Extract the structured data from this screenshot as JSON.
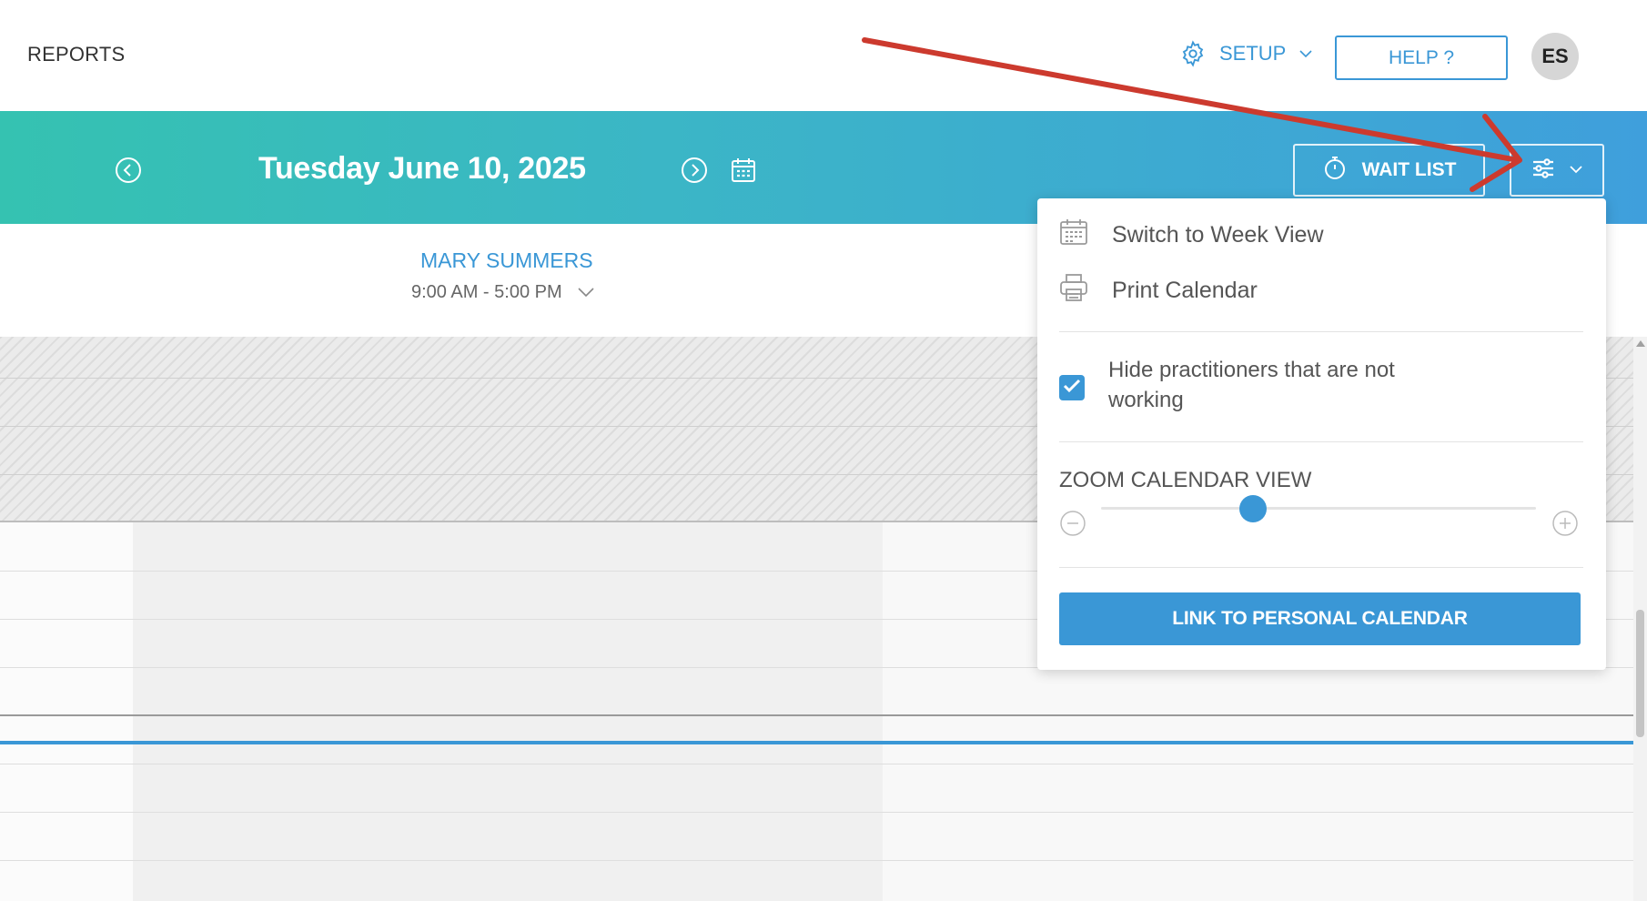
{
  "topbar": {
    "reports_label": "REPORTS",
    "setup_label": "SETUP",
    "help_label": "HELP ?",
    "avatar_initials": "ES"
  },
  "header": {
    "date_title": "Tuesday June 10, 2025",
    "waitlist_label": "WAIT LIST"
  },
  "practitioner": {
    "name": "MARY SUMMERS",
    "hours": "9:00 AM - 5:00 PM"
  },
  "dropdown": {
    "week_view_label": "Switch to Week View",
    "print_label": "Print Calendar",
    "hide_practitioners_label": "Hide practitioners that are not working",
    "hide_practitioners_checked": true,
    "zoom_label": "ZOOM CALENDAR VIEW",
    "zoom_level_fraction": 0.35,
    "link_button_label": "LINK TO PERSONAL CALENDAR"
  },
  "colors": {
    "accent": "#3a97d6",
    "band_start": "#35c2b1",
    "band_end": "#3f9fdc",
    "annotation_arrow": "#cc3a2e"
  },
  "icons": [
    "settings-gear-icon",
    "chevron-down-icon",
    "chevron-left-circle-icon",
    "chevron-right-circle-icon",
    "calendar-icon",
    "stopwatch-icon",
    "sliders-icon",
    "printer-icon",
    "checkmark-icon",
    "minus-circle-icon",
    "plus-circle-icon"
  ]
}
